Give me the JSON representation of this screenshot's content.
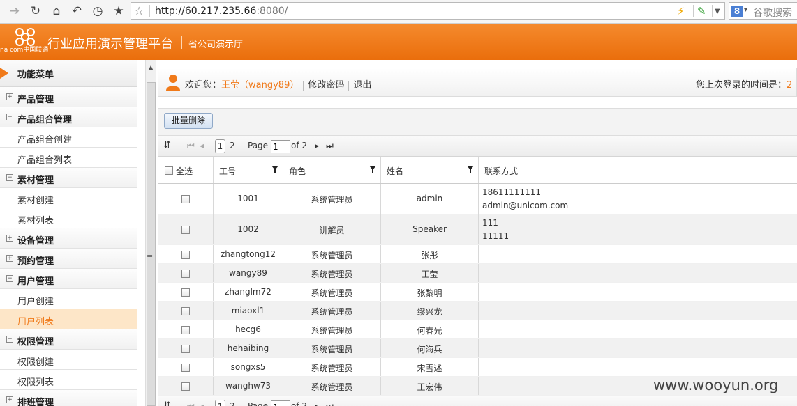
{
  "browser": {
    "url_host": "http://60.217.235.66",
    "url_port_path": ":8080/",
    "search_placeholder": "谷歌搜索",
    "search_engine_letter": "8"
  },
  "header": {
    "logo_small_text": "na com中国联通",
    "title": "行业应用演示管理平台",
    "subtitle": "省公司演示厅",
    "brand_color": "#f07a1a"
  },
  "sidebar": {
    "heading": "功能菜单",
    "items": [
      {
        "label": "产品管理",
        "type": "group",
        "expanded": false
      },
      {
        "label": "产品组合管理",
        "type": "group",
        "expanded": true
      },
      {
        "label": "产品组合创建",
        "type": "child"
      },
      {
        "label": "产品组合列表",
        "type": "child"
      },
      {
        "label": "素材管理",
        "type": "group",
        "expanded": true
      },
      {
        "label": "素材创建",
        "type": "child"
      },
      {
        "label": "素材列表",
        "type": "child"
      },
      {
        "label": "设备管理",
        "type": "group",
        "expanded": false
      },
      {
        "label": "预约管理",
        "type": "group",
        "expanded": false
      },
      {
        "label": "用户管理",
        "type": "group",
        "expanded": true
      },
      {
        "label": "用户创建",
        "type": "child"
      },
      {
        "label": "用户列表",
        "type": "child",
        "active": true
      },
      {
        "label": "权限管理",
        "type": "group",
        "expanded": true
      },
      {
        "label": "权限创建",
        "type": "child"
      },
      {
        "label": "权限列表",
        "type": "child"
      },
      {
        "label": "排班管理",
        "type": "group",
        "expanded": false
      }
    ]
  },
  "welcome": {
    "prefix": "欢迎您：",
    "user": "王莹（wangy89）",
    "change_password": "修改密码",
    "logout": "退出",
    "last_login_label": "您上次登录的时间是：",
    "last_login_value": "2"
  },
  "toolbar": {
    "batch_delete": "批量删除"
  },
  "pager": {
    "page_1": "1",
    "page_2": "2",
    "page_label": "Page",
    "page_input": "1",
    "of_label": "of 2"
  },
  "grid": {
    "headers": {
      "select_all": "全选",
      "emp_id": "工号",
      "role": "角色",
      "name": "姓名",
      "contact": "联系方式"
    },
    "rows": [
      {
        "emp_id": "1001",
        "role": "系统管理员",
        "name": "admin",
        "contact1": "18611111111",
        "contact2": "admin@unicom.com"
      },
      {
        "emp_id": "1002",
        "role": "讲解员",
        "name": "Speaker",
        "contact1": "111",
        "contact2": "11111"
      },
      {
        "emp_id": "zhangtong12",
        "role": "系统管理员",
        "name": "张彤",
        "contact1": "",
        "contact2": ""
      },
      {
        "emp_id": "wangy89",
        "role": "系统管理员",
        "name": "王莹",
        "contact1": "",
        "contact2": ""
      },
      {
        "emp_id": "zhanglm72",
        "role": "系统管理员",
        "name": "张黎明",
        "contact1": "",
        "contact2": ""
      },
      {
        "emp_id": "miaoxl1",
        "role": "系统管理员",
        "name": "缪兴龙",
        "contact1": "",
        "contact2": ""
      },
      {
        "emp_id": "hecg6",
        "role": "系统管理员",
        "name": "何春光",
        "contact1": "",
        "contact2": ""
      },
      {
        "emp_id": "hehaibing",
        "role": "系统管理员",
        "name": "何海兵",
        "contact1": "",
        "contact2": ""
      },
      {
        "emp_id": "songxs5",
        "role": "系统管理员",
        "name": "宋雪述",
        "contact1": "",
        "contact2": ""
      },
      {
        "emp_id": "wanghw73",
        "role": "系统管理员",
        "name": "王宏伟",
        "contact1": "",
        "contact2": ""
      }
    ]
  },
  "watermark": "www.wooyun.org"
}
